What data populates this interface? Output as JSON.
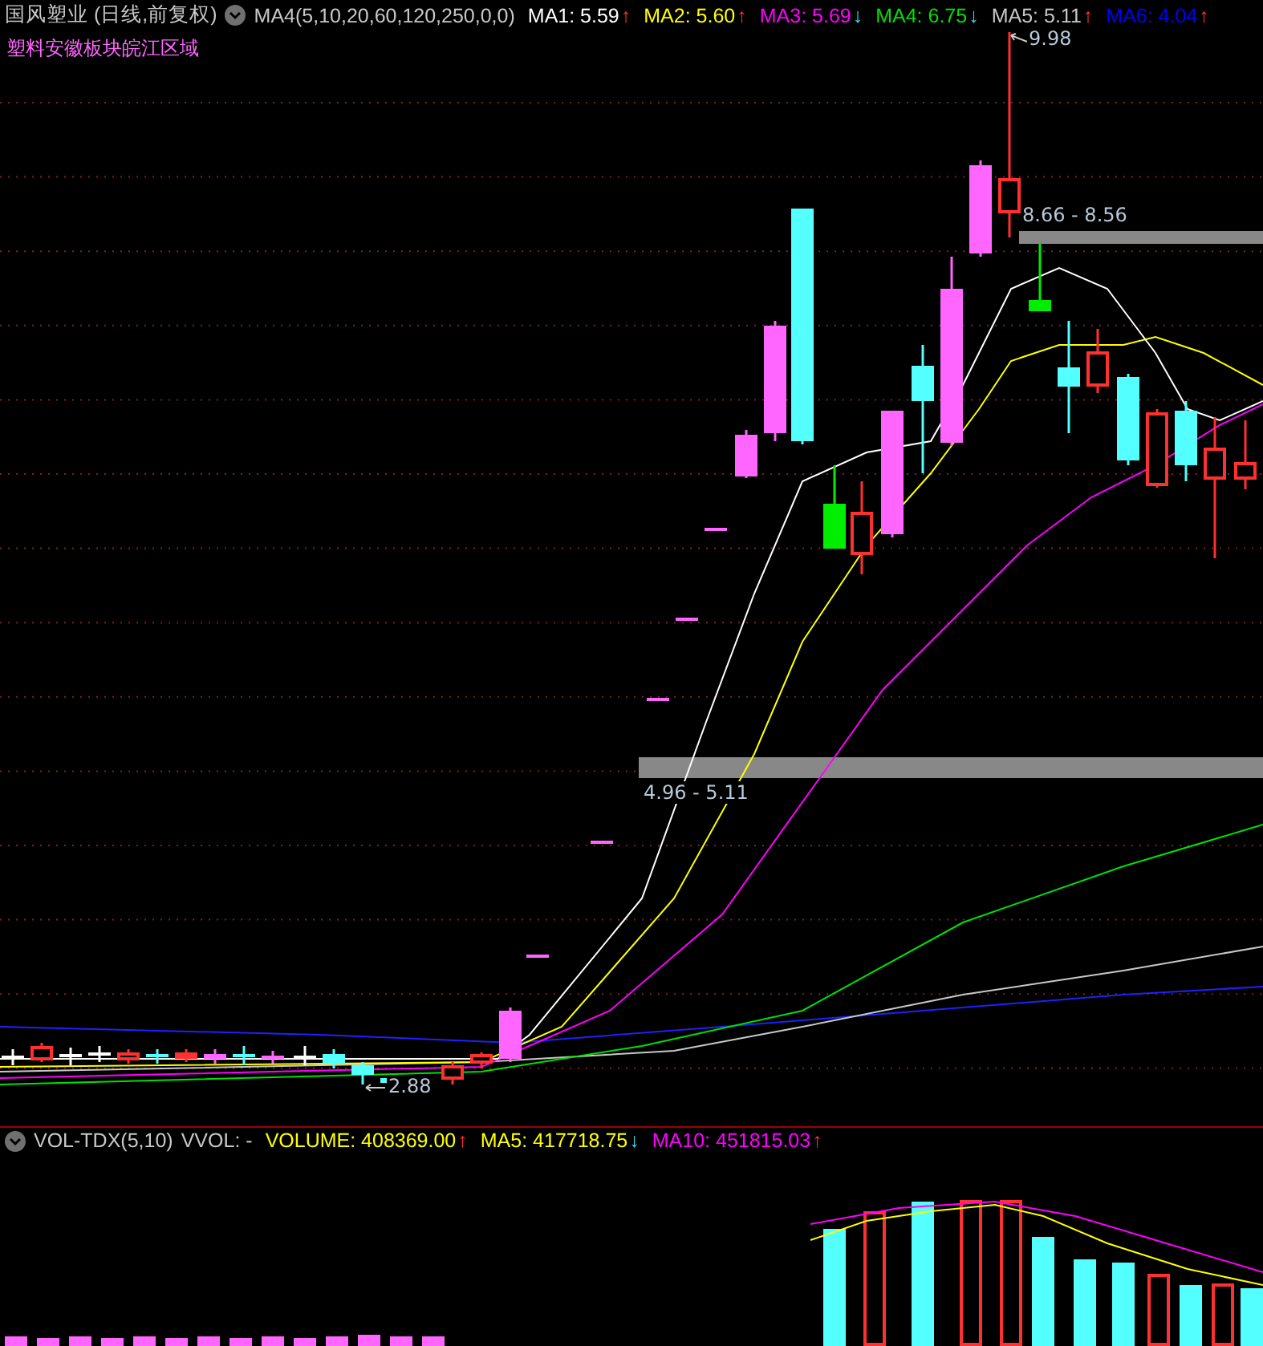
{
  "main_panel": {
    "stock_title": "国风塑业 (日线,前复权)",
    "indicator_name": "MA4(5,10,20,60,120,250,0,0)",
    "ma_readings": [
      {
        "label": "MA1: 5.59",
        "color": "#ffffff",
        "arrow": {
          "symbol": "↑",
          "color": "#ff3030"
        }
      },
      {
        "label": "MA2: 5.60",
        "color": "#ffff00",
        "arrow": {
          "symbol": "↑",
          "color": "#ff3030"
        }
      },
      {
        "label": "MA3: 5.69",
        "color": "#ff00ff",
        "arrow": {
          "symbol": "↓",
          "color": "#30e0f0"
        }
      },
      {
        "label": "MA4: 6.75",
        "color": "#00e000",
        "arrow": {
          "symbol": "↓",
          "color": "#30e0f0"
        }
      },
      {
        "label": "MA5: 5.11",
        "color": "#c8c8c8",
        "arrow": {
          "symbol": "↑",
          "color": "#ff3030"
        }
      },
      {
        "label": "MA6: 4.04",
        "color": "#0000ff",
        "arrow": {
          "symbol": "↑",
          "color": "#ff3030"
        }
      }
    ],
    "sector_label": "塑料安徽板块皖江区域",
    "annotations": [
      {
        "kind": "high",
        "text": "9.98"
      },
      {
        "kind": "zone",
        "text": "8.66 - 8.56"
      },
      {
        "kind": "zone",
        "text": "4.96 - 5.11"
      },
      {
        "kind": "low",
        "text": "2.88"
      }
    ]
  },
  "volume_panel": {
    "indicator_name": "VOL-TDX(5,10)",
    "vvol": "VVOL: -",
    "readings": [
      {
        "label": "VOLUME: 408369.00",
        "color": "#ffff00",
        "arrow": {
          "symbol": "↑",
          "color": "#ff3030"
        }
      },
      {
        "label": "MA5: 417718.75",
        "color": "#ffff00",
        "arrow": {
          "symbol": "↓",
          "color": "#30e0f0"
        }
      },
      {
        "label": "MA10: 451815.03",
        "color": "#ff00ff",
        "arrow": {
          "symbol": "↑",
          "color": "#ff3030"
        }
      }
    ]
  }
}
